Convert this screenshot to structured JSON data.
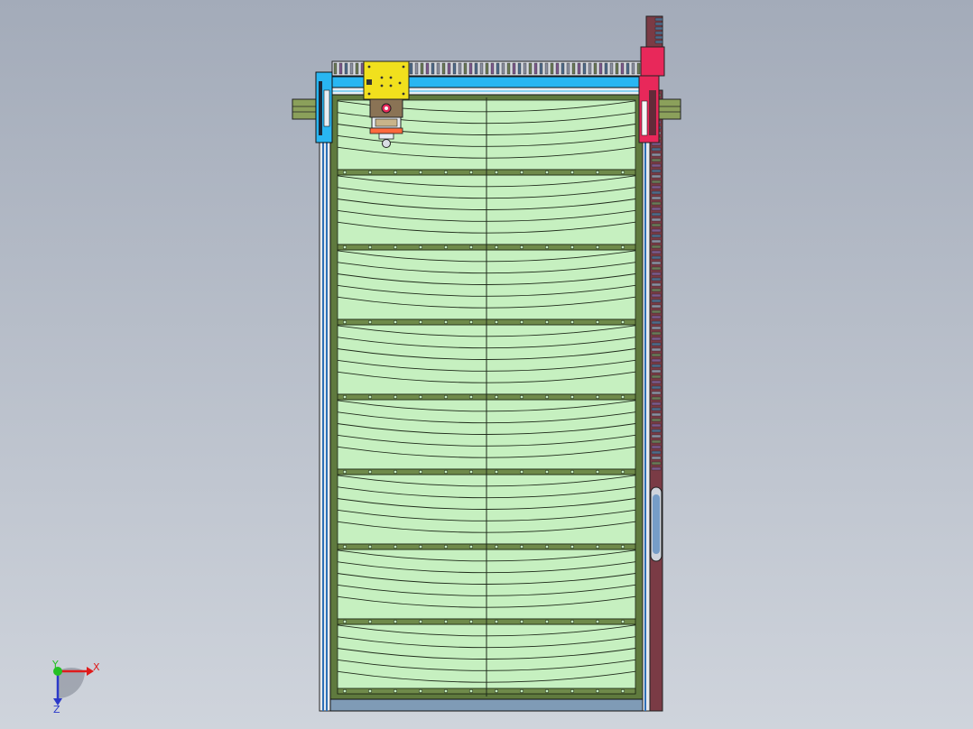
{
  "viewport": {
    "background_top": "#a3abb9",
    "background_bottom": "#cfd4dc"
  },
  "model": {
    "screen_panel_color": "#c6f0c0",
    "panel_line_color": "#1f2a1a",
    "frame_color": "#5f7a3e",
    "crossbar_color": "#6f8a4a",
    "gantry_beam_color": "#29b6f2",
    "gear_rack_color": "#8a8fa0",
    "trolley_color": "#f1e01d",
    "drive_motor_color": "#e8285a",
    "side_rail_color": "#7a3b45",
    "left_column_color": "#2e6fb6",
    "panel_rows": 8,
    "panel_columns": 2,
    "curves_per_row": 5
  },
  "triad": {
    "x_label": "X",
    "y_label": "Y",
    "z_label": "Z",
    "x_color": "#e01b1b",
    "y_color": "#25c024",
    "z_color": "#2b39c9"
  }
}
